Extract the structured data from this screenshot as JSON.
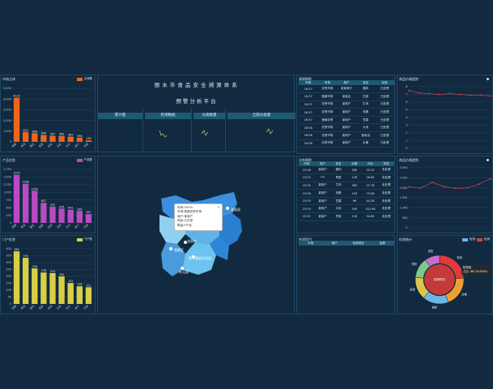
{
  "header": {
    "title": "丽 水 市 食 品 安 全 溯 源 体 系",
    "subtitle": "预 警 分 析 平 台"
  },
  "stats": [
    {
      "title": "累计量"
    },
    {
      "title": "检测数据"
    },
    {
      "title": "分类数量"
    },
    {
      "title": "全部分类量"
    }
  ],
  "left_top": {
    "title": "市场主体",
    "legend": "主体数",
    "color": "#f0641e"
  },
  "left_mid": {
    "title": "产品信息",
    "legend": "产品数",
    "color": "#b84ac2"
  },
  "left_bot": {
    "title": "门户信息",
    "legend": "门户数",
    "color": "#d8cf45"
  },
  "tr_table": {
    "title": "溯源跟踪",
    "headers": [
      "时间",
      "市场",
      "商户",
      "品名",
      "状态"
    ],
    "rows": [
      [
        "16:57",
        "农贸市场",
        "某某商行",
        "猪肉",
        "已处理"
      ],
      [
        "16:57",
        "莲都市场",
        "某某店",
        "白菜",
        "已处理"
      ],
      [
        "16:57",
        "农贸市场",
        "某商户",
        "牛肉",
        "已处理"
      ],
      [
        "16:57",
        "农贸市场",
        "某商户",
        "鸡蛋",
        "已处理"
      ],
      [
        "16:57",
        "莲都农贸",
        "某商户",
        "豆腐",
        "已处理"
      ],
      [
        "16:56",
        "农贸市场",
        "某商户",
        "大米",
        "已处理"
      ],
      [
        "16:56",
        "农贸市场",
        "某商户",
        "食用油",
        "已处理"
      ],
      [
        "16:56",
        "农贸市场",
        "某商户",
        "水果",
        "已处理"
      ]
    ]
  },
  "mr_table": {
    "title": "分拣跟踪",
    "headers": [
      "时间",
      "商户",
      "品名",
      "价格",
      "均价",
      "状态"
    ],
    "rows": [
      [
        "15:56",
        "某商户",
        "猪肉",
        "289",
        "35.25",
        "未处理"
      ],
      [
        "15:55",
        "***",
        "青菜",
        "136",
        "26.85",
        "未处理"
      ],
      [
        "15:55",
        "某商户",
        "牛肉",
        "389",
        "37.78",
        "未处理"
      ],
      [
        "15:56",
        "某商户",
        "鸡蛋",
        "156",
        "75.56",
        "未处理"
      ],
      [
        "15:53",
        "某商户",
        "豆腐",
        "96",
        "44.28",
        "未处理"
      ],
      [
        "15:53",
        "某商户",
        "大米",
        "290",
        "102.96",
        "未处理"
      ],
      [
        "15:51",
        "某商户",
        "芹菜",
        "126",
        "34.85",
        "未处理"
      ]
    ]
  },
  "br_table": {
    "title": "检测项目",
    "headers": [
      "市场",
      "商户",
      "检测项目",
      "结果"
    ]
  },
  "chart_data": [
    {
      "type": "bar",
      "title": "市场主体",
      "categories": [
        "莲都",
        "青田",
        "缙云",
        "遂昌",
        "松阳",
        "云和",
        "庆元",
        "景宁",
        "龙泉"
      ],
      "values": [
        4123,
        922,
        806,
        640,
        567,
        560,
        483,
        396,
        139
      ],
      "ylim": [
        0,
        5000
      ],
      "yticks": [
        0,
        1000,
        2000,
        3000,
        4000,
        5000
      ],
      "color": "#f0641e"
    },
    {
      "type": "bar",
      "title": "产品信息",
      "categories": [
        "莲都",
        "青田",
        "缙云",
        "遂昌",
        "松阳",
        "云和",
        "庆元",
        "景宁",
        "龙泉"
      ],
      "values": [
        1573,
        1280,
        1050,
        657,
        532,
        470,
        431,
        390,
        287
      ],
      "ylim": [
        0,
        1750
      ],
      "yticks": [
        0,
        250,
        500,
        750,
        1000,
        1250,
        1500,
        1750
      ],
      "color": "#b84ac2"
    },
    {
      "type": "bar",
      "title": "门户信息",
      "categories": [
        "莲都",
        "青田",
        "缙云",
        "遂昌",
        "松阳",
        "云和",
        "庆元",
        "景宁",
        "龙泉"
      ],
      "values": [
        382,
        335,
        258,
        228,
        224,
        200,
        152,
        128,
        121
      ],
      "ylim": [
        0,
        400
      ],
      "yticks": [
        0,
        50,
        100,
        150,
        200,
        250,
        300,
        350,
        400
      ],
      "color": "#d8cf45"
    },
    {
      "type": "line",
      "title": "商品价格趋势",
      "x": [
        1,
        2,
        3,
        4,
        5,
        6,
        7,
        8,
        9
      ],
      "values": [
        7.5,
        7.2,
        7.1,
        7.0,
        7.1,
        7.0,
        6.9,
        6.9,
        6.8
      ],
      "ylim": [
        0,
        8
      ],
      "yticks": [
        0,
        1,
        2,
        3,
        4,
        5,
        6,
        7,
        8
      ],
      "color": "#e0404a"
    },
    {
      "type": "line",
      "title": "商品价格趋势",
      "x": [
        1,
        2,
        3,
        4,
        5,
        6,
        7,
        8
      ],
      "values": [
        2050,
        1980,
        2270,
        2060,
        1970,
        1990,
        2180,
        2450
      ],
      "ylim": [
        0,
        3000
      ],
      "yticks": [
        0,
        500,
        1000,
        1500,
        2000,
        2500,
        3000
      ],
      "color": "#e0404a"
    },
    {
      "type": "pie",
      "title": "检测统计",
      "legend": [
        "检测",
        "检测"
      ],
      "center_label": "检测项目",
      "tooltip": "检测品",
      "tooltip_value": "占比: 48 (24.00%)",
      "slices": [
        {
          "label": "检测",
          "value": 48,
          "color": "#e23a3a"
        },
        {
          "label": "合格",
          "value": 40,
          "color": "#f0a030"
        },
        {
          "label": "抽检",
          "value": 35,
          "color": "#6fb6e6"
        },
        {
          "label": "复检",
          "value": 30,
          "color": "#d7c84a"
        },
        {
          "label": "快检",
          "value": 27,
          "color": "#7fc78a"
        },
        {
          "label": "送检",
          "value": 20,
          "color": "#c36fd0"
        }
      ]
    }
  ],
  "map": {
    "tooltip_lines": [
      "时间:16:59",
      "市场:莲都农贸市场",
      "商户:某商户",
      "商品:大白菜",
      "数量:5千克"
    ],
    "labels": [
      "遂昌县",
      "莲都区",
      "景宁畲族自治县",
      "庆元县",
      "龙泉市"
    ],
    "close": "×"
  }
}
